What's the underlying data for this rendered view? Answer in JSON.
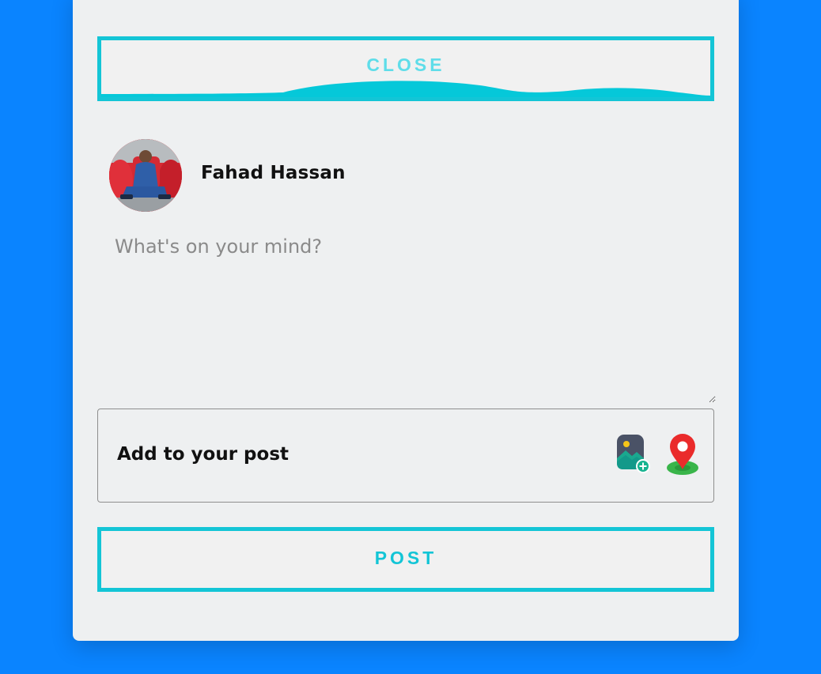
{
  "modal": {
    "close_label": "CLOSE",
    "post_label": "POST"
  },
  "user": {
    "name": "Fahad Hassan",
    "avatar_icon": "avatar"
  },
  "composer": {
    "placeholder": "What's on your mind?",
    "value": ""
  },
  "add_to_post": {
    "label": "Add to your post",
    "actions": [
      {
        "icon": "photo-add-icon"
      },
      {
        "icon": "location-pin-icon"
      }
    ]
  },
  "colors": {
    "background": "#0a84ff",
    "card": "#eef0f1",
    "accent": "#13c5d6"
  }
}
